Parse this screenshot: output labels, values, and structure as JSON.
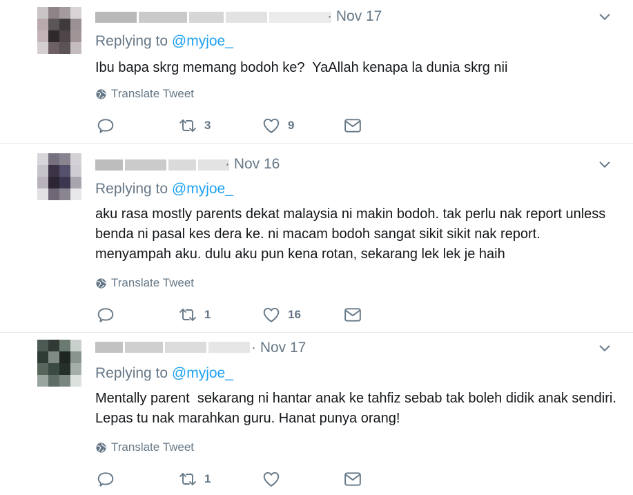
{
  "tweets": [
    {
      "date": "· Nov 17",
      "replying_prefix": "Replying to",
      "replying_handle": "@myjoe_",
      "text": "Ibu bapa skrg memang bodoh ke?  YaAllah kenapa la dunia skrg nii",
      "translate": "Translate Tweet",
      "reply_count": "",
      "retweet_count": "3",
      "like_count": "9"
    },
    {
      "date": "· Nov 16",
      "replying_prefix": "Replying to",
      "replying_handle": "@myjoe_",
      "text": "aku rasa mostly parents dekat malaysia ni makin bodoh. tak perlu nak report unless benda ni pasal kes dera ke. ni macam bodoh sangat sikit sikit nak report. menyampah aku. dulu aku pun kena rotan, sekarang lek lek je haih",
      "translate": "Translate Tweet",
      "reply_count": "",
      "retweet_count": "1",
      "like_count": "16"
    },
    {
      "date": "· Nov 17",
      "replying_prefix": "Replying to",
      "replying_handle": "@myjoe_",
      "text": "Mentally parent  sekarang ni hantar anak ke tahfiz sebab tak boleh didik anak sendiri. Lepas tu nak marahkan guru. Hanat punya orang!",
      "translate": "Translate Tweet",
      "reply_count": "",
      "retweet_count": "1",
      "like_count": ""
    }
  ],
  "colors": {
    "secondary_text": "#657786",
    "link": "#1da1f2",
    "divider": "#e6ecf0"
  },
  "icons": [
    "globe-icon",
    "reply-icon",
    "retweet-icon",
    "like-icon",
    "direct-message-icon",
    "chevron-down-icon"
  ]
}
